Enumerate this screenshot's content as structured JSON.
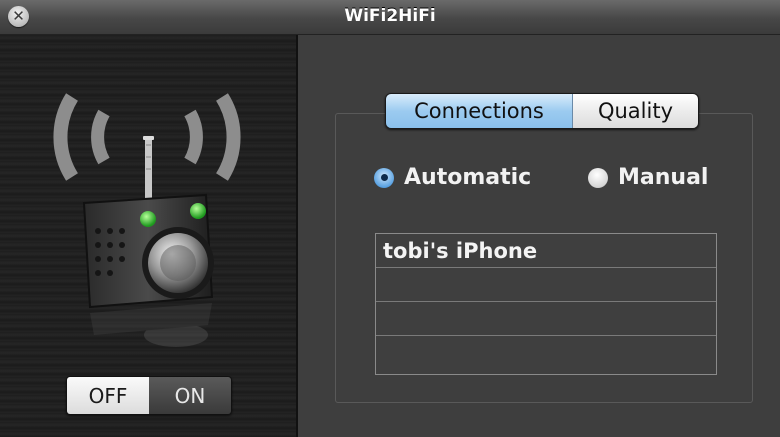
{
  "window": {
    "title": "WiFi2HiFi",
    "close_glyph": "✕"
  },
  "tabs": [
    {
      "label": "Connections",
      "selected": true
    },
    {
      "label": "Quality",
      "selected": false
    }
  ],
  "mode": {
    "options": [
      {
        "label": "Automatic",
        "selected": true
      },
      {
        "label": "Manual",
        "selected": false
      }
    ]
  },
  "connections": {
    "rows": [
      "tobi's iPhone",
      "",
      "",
      ""
    ]
  },
  "power": {
    "off_label": "OFF",
    "on_label": "ON",
    "state": "OFF"
  },
  "colors": {
    "accent": "#8ac0ec",
    "led": "#35d33a"
  }
}
